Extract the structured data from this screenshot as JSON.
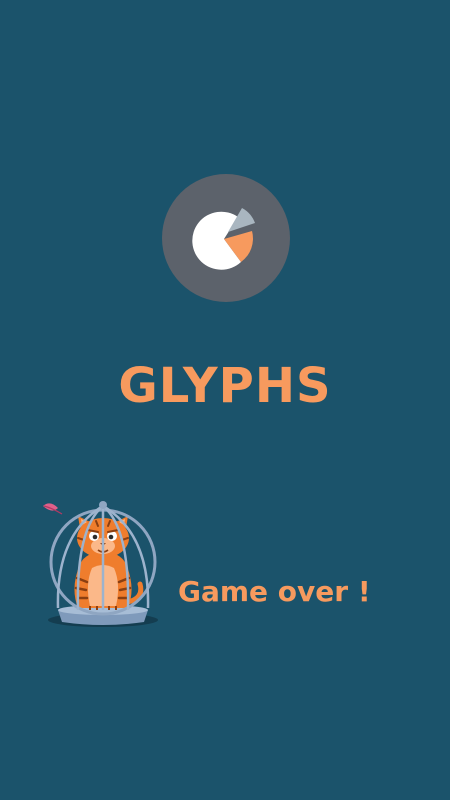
{
  "app": {
    "title": "GLYPHS",
    "logo_icon": "pie-chart-icon"
  },
  "result": {
    "status_text": "Game over !",
    "mascot": "caged-tiger-illustration",
    "feather": "feather-icon"
  },
  "colors": {
    "background": "#1b536b",
    "accent": "#f79a5e",
    "logo_badge": "#5c626b",
    "pie_white": "#ffffff",
    "pie_orange": "#f79a5e",
    "pie_slice_grey": "#a9b6c0",
    "cage": "#8fa6c2",
    "tiger": "#ef7d2d"
  }
}
